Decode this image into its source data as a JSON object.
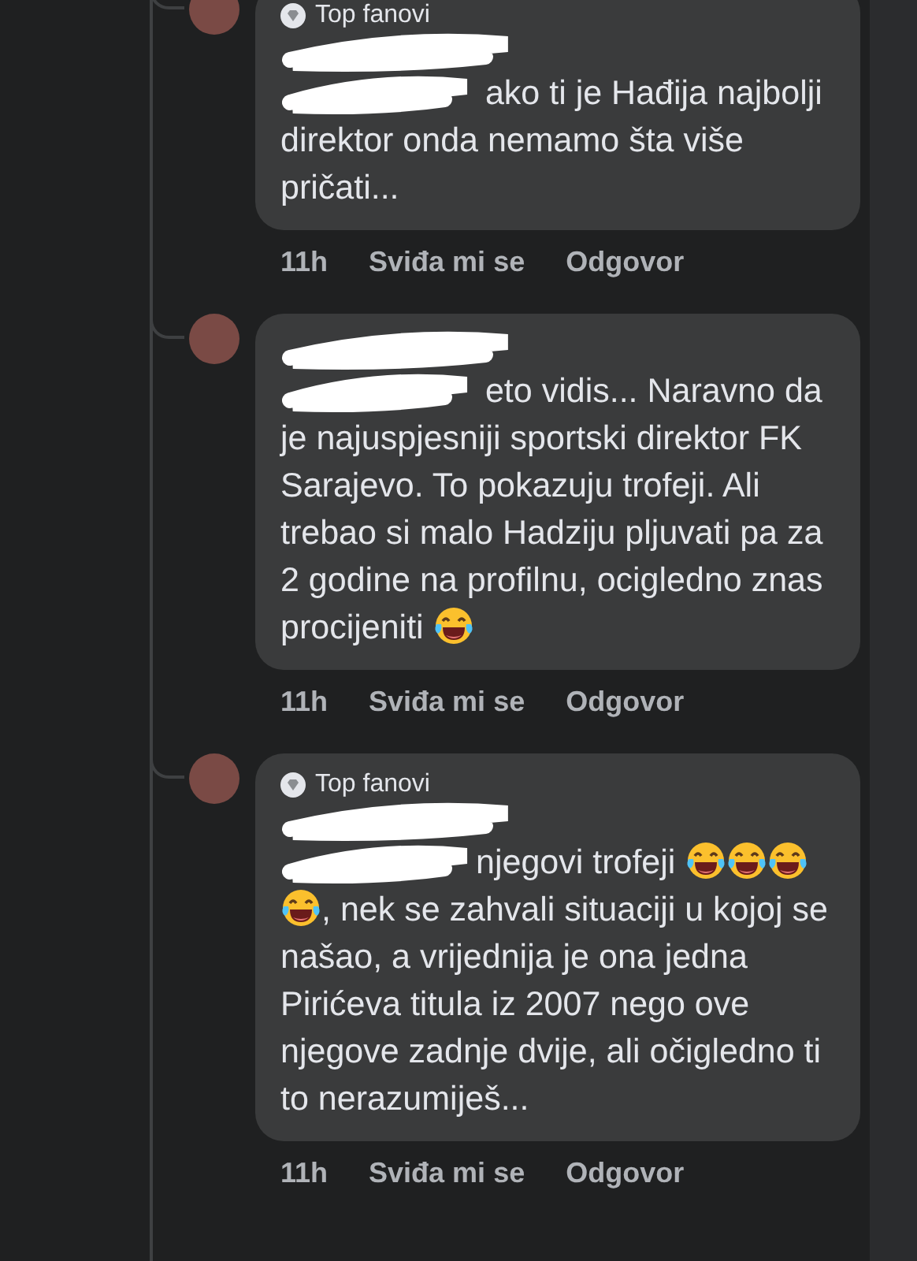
{
  "comments": [
    {
      "badge": "Top fanovi",
      "author_redacted": true,
      "body": [
        {
          "kind": "mention"
        },
        {
          "kind": "text",
          "text": " ako ti je Hađija najbolji direktor onda nemamo šta više pričati..."
        }
      ],
      "actions": [
        "11h",
        "Sviđa mi se",
        "Odgovor"
      ]
    },
    {
      "author_redacted": true,
      "body": [
        {
          "kind": "mention"
        },
        {
          "kind": "text",
          "text": " eto vidis... Naravno da je najuspjesniji sportski direktor FK Sarajevo. To pokazuju trofeji. Ali trebao si malo Hadziju pljuvati pa za 2 godine na profilnu, ocigledno znas procijeniti "
        },
        {
          "kind": "emoji"
        }
      ],
      "actions": [
        "11h",
        "Sviđa mi se",
        "Odgovor"
      ]
    },
    {
      "badge": "Top fanovi",
      "author_redacted": true,
      "body": [
        {
          "kind": "mention"
        },
        {
          "kind": "text",
          "text": "njegovi trofeji "
        },
        {
          "kind": "emoji"
        },
        {
          "kind": "emoji"
        },
        {
          "kind": "emoji"
        },
        {
          "kind": "emoji"
        },
        {
          "kind": "text",
          "text": ", nek se zahvali situaciji u kojoj se našao, a vrijednija je ona jedna Pirićeva titula iz 2007 nego ove njegove zadnje dvije, ali očigledno ti to nerazumiješ..."
        }
      ],
      "actions": [
        "11h",
        "Sviđa mi se",
        "Odgovor"
      ]
    }
  ]
}
